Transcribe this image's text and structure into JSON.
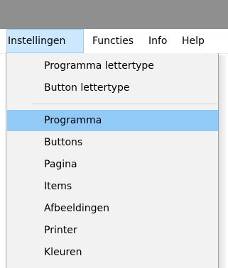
{
  "menubar": {
    "items": [
      {
        "label": "Instellingen",
        "active": true
      },
      {
        "label": "Functies",
        "active": false
      },
      {
        "label": "Info",
        "active": false
      },
      {
        "label": "Help",
        "active": false
      }
    ]
  },
  "dropdown": {
    "items": [
      {
        "label": "Programma lettertype"
      },
      {
        "label": "Button lettertype"
      },
      {
        "label": "Programma",
        "highlighted": true
      },
      {
        "label": "Buttons"
      },
      {
        "label": "Pagina"
      },
      {
        "label": "Items"
      },
      {
        "label": "Afbeeldingen"
      },
      {
        "label": "Printer"
      },
      {
        "label": "Kleuren"
      }
    ]
  },
  "colors": {
    "title_bar": "#8f8f8f",
    "menu_background": "#f2f2f2",
    "highlight": "#91c9f7",
    "active_menu_background": "#cce8ff",
    "active_menu_border": "#99d1ff"
  }
}
